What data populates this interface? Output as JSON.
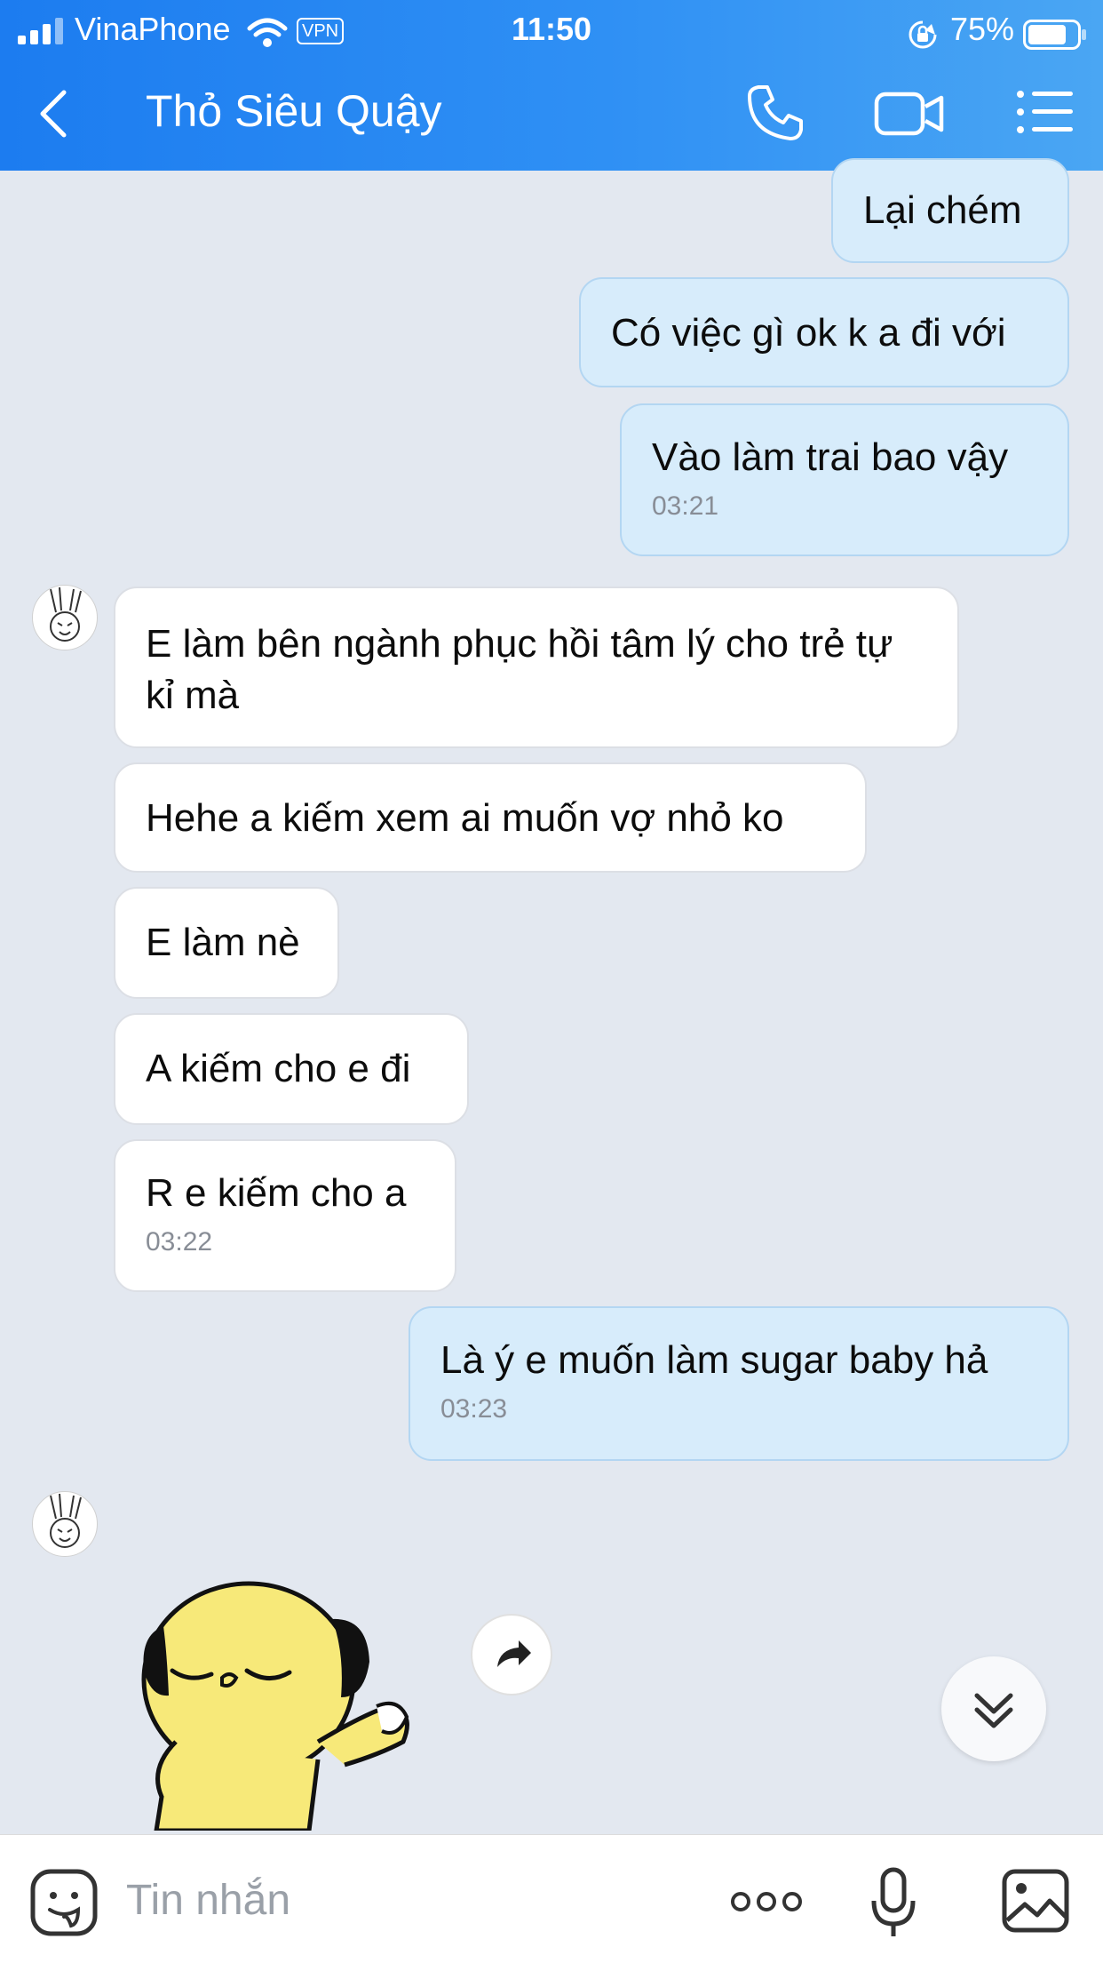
{
  "status_bar": {
    "carrier": "VinaPhone",
    "vpn": "VPN",
    "time": "11:50",
    "battery": "75%"
  },
  "header": {
    "title": "Thỏ Siêu Quậy"
  },
  "messages": [
    {
      "text": "Lại chém"
    },
    {
      "text": "Có việc gì ok k a đi với"
    },
    {
      "text": "Vào làm trai bao vậy",
      "time": "03:21"
    },
    {
      "text": "E làm bên ngành phục hồi tâm lý cho trẻ tự kỉ mà"
    },
    {
      "text": "Hehe a kiếm xem ai muốn vợ nhỏ ko"
    },
    {
      "text": "E làm nè"
    },
    {
      "text": "A kiếm cho e đi"
    },
    {
      "text": "R e kiếm cho a",
      "time": "03:22"
    },
    {
      "text": "Là ý e muốn làm sugar baby hả",
      "time": "03:23"
    }
  ],
  "input": {
    "placeholder": "Tin nhắn"
  },
  "colors": {
    "header_start": "#1c7cf0",
    "header_end": "#4aa6f3",
    "outgoing_bubble": "#d7ecfb",
    "incoming_bubble": "#ffffff",
    "background": "#e3e8f0"
  }
}
